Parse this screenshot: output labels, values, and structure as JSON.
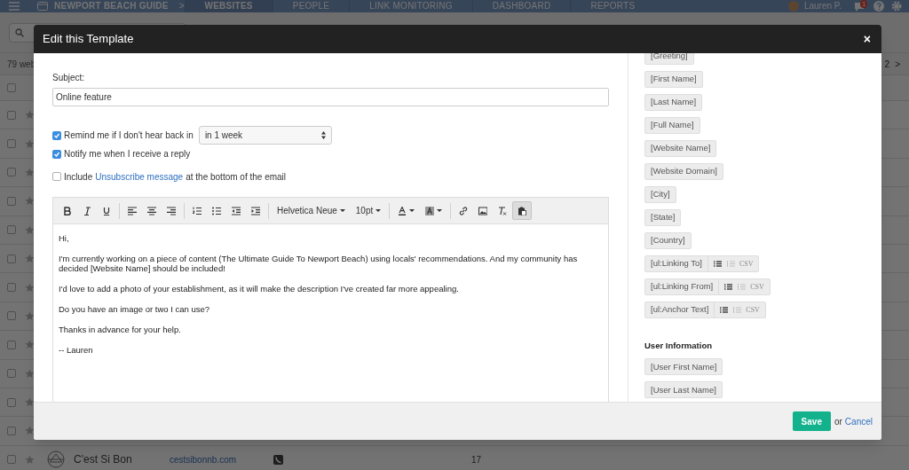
{
  "app": {
    "project": "NEWPORT BEACH GUIDE",
    "separator": ">",
    "tabs": [
      {
        "label": "WEBSITES",
        "selected": true
      },
      {
        "label": "PEOPLE",
        "selected": false
      },
      {
        "label": "LINK MONITORING",
        "selected": false
      },
      {
        "label": "DASHBOARD",
        "selected": false
      },
      {
        "label": "REPORTS",
        "selected": false
      }
    ],
    "user": "Lauren P.",
    "notification_badge": "1",
    "list": {
      "count_label": "79 web",
      "page": "2",
      "page_next": ">",
      "header_checked": false,
      "rows": [
        {
          "checked": false
        },
        {
          "checked": false
        },
        {
          "checked": false
        },
        {
          "checked": false
        },
        {
          "checked": false
        },
        {
          "checked": false
        },
        {
          "checked": false
        },
        {
          "checked": false
        },
        {
          "checked": false
        },
        {
          "checked": false
        },
        {
          "checked": false
        },
        {
          "checked": false
        },
        {
          "checked": false,
          "name": "C'est Si Bon",
          "url": "cestsibonnb.com",
          "count": "17"
        }
      ]
    }
  },
  "modal": {
    "title": "Edit this Template",
    "close": "×",
    "subject_label": "Subject:",
    "subject_value": "Online feature",
    "options": [
      {
        "kind": "remind",
        "label": "Remind me if I don't hear back in",
        "checked": true,
        "select": "in 1 week"
      },
      {
        "kind": "plain",
        "label": "Notify me when I receive a reply",
        "checked": true
      },
      {
        "kind": "link",
        "before": "Include",
        "link": "Unsubscribe message",
        "after": "at the bottom of the email",
        "checked": false
      }
    ],
    "toolbar": [
      [
        {
          "kind": "bold",
          "pressed": false
        },
        {
          "kind": "italic",
          "pressed": false
        },
        {
          "kind": "underline",
          "pressed": false
        }
      ],
      [
        {
          "kind": "align-left",
          "pressed": false
        },
        {
          "kind": "align-center",
          "pressed": false
        },
        {
          "kind": "align-right",
          "pressed": false
        }
      ],
      [
        {
          "kind": "ordered-list",
          "pressed": false
        },
        {
          "kind": "bullet-list",
          "pressed": false
        },
        {
          "kind": "outdent",
          "pressed": false
        },
        {
          "kind": "indent",
          "pressed": false
        }
      ],
      [
        {
          "kind": "font",
          "label": "Helvetica Neue",
          "pressed": false
        },
        {
          "kind": "size",
          "label": "10pt",
          "pressed": false
        }
      ],
      [
        {
          "kind": "text-color",
          "pressed": false
        },
        {
          "kind": "background-color",
          "pressed": false
        }
      ],
      [
        {
          "kind": "link",
          "pressed": false
        },
        {
          "kind": "image",
          "pressed": false
        },
        {
          "kind": "clear-format",
          "pressed": false
        },
        {
          "kind": "paste",
          "pressed": true
        }
      ]
    ],
    "body": [
      "Hi,",
      "I'm currently working on a piece of content (The Ultimate Guide To Newport Beach) using locals' recommendations. And my community has decided [Website Name] should be included!",
      "I'd love to add a photo of your establishment, as it will make the description I've created far more appealing.",
      "Do you have an image or two I can use?",
      "Thanks in advance for your help.",
      "-- Lauren"
    ],
    "sections": [
      {
        "items": [
          {
            "kind": "plain",
            "label": "[Greeting]"
          },
          {
            "kind": "plain",
            "label": "[First Name]"
          },
          {
            "kind": "plain",
            "label": "[Last Name]"
          },
          {
            "kind": "plain",
            "label": "[Full Name]"
          },
          {
            "kind": "plain",
            "label": "[Website Name]"
          },
          {
            "kind": "plain",
            "label": "[Website Domain]"
          },
          {
            "kind": "plain",
            "label": "[City]"
          },
          {
            "kind": "plain",
            "label": "[State]"
          },
          {
            "kind": "plain",
            "label": "[Country]"
          },
          {
            "kind": "list",
            "label": "[ul:Linking To]",
            "csv": "CSV"
          },
          {
            "kind": "list",
            "label": "[ul:Linking From]",
            "csv": "CSV"
          },
          {
            "kind": "list",
            "label": "[ul:Anchor Text]",
            "csv": "CSV"
          }
        ]
      },
      {
        "heading": "User Information",
        "items": [
          {
            "kind": "plain",
            "label": "[User First Name]"
          },
          {
            "kind": "plain",
            "label": "[User Last Name]"
          }
        ]
      }
    ],
    "save": "Save",
    "or": "or",
    "cancel": "Cancel"
  }
}
